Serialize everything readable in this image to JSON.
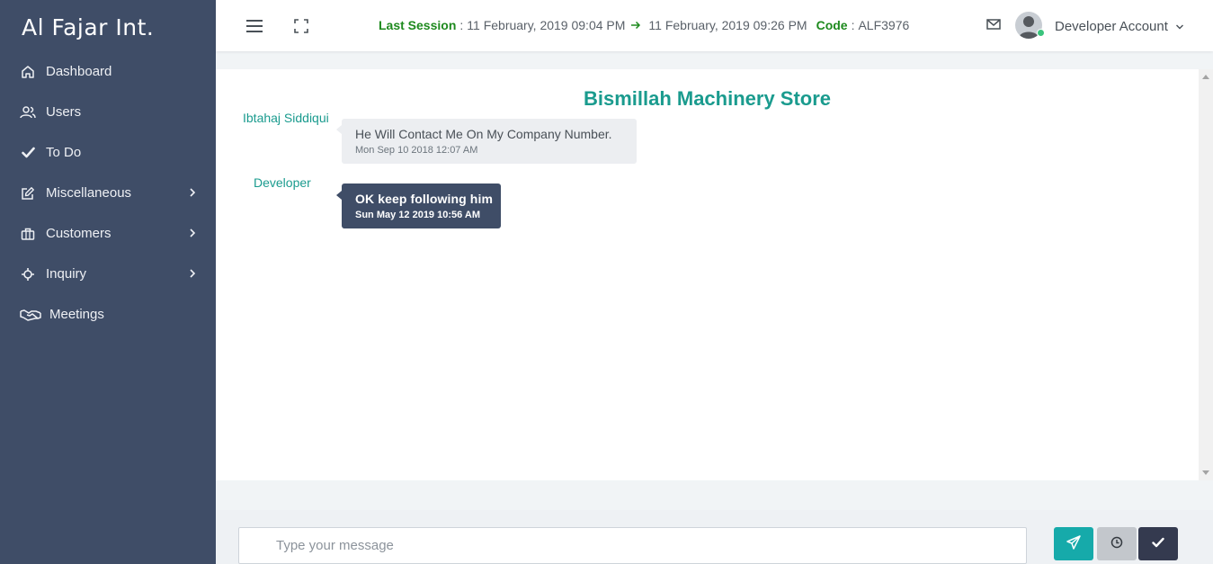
{
  "brand": "Al Fajar Int.",
  "sidebar": {
    "items": [
      {
        "label": "Dashboard",
        "icon": "home-icon",
        "has_children": false
      },
      {
        "label": "Users",
        "icon": "users-icon",
        "has_children": false
      },
      {
        "label": "To Do",
        "icon": "check-icon",
        "has_children": false
      },
      {
        "label": "Miscellaneous",
        "icon": "edit-icon",
        "has_children": true
      },
      {
        "label": "Customers",
        "icon": "briefcase-icon",
        "has_children": true
      },
      {
        "label": "Inquiry",
        "icon": "crosshair-icon",
        "has_children": true
      },
      {
        "label": "Meetings",
        "icon": "handshake-icon",
        "has_children": false
      }
    ]
  },
  "header": {
    "last_session_label": "Last Session",
    "session_start": "11 February, 2019 09:04 PM",
    "session_end": "11 February, 2019 09:26 PM",
    "code_label": "Code",
    "code_value": "ALF3976",
    "account_name": "Developer Account"
  },
  "chat": {
    "title": "Bismillah Machinery Store",
    "messages": [
      {
        "sender": "Ibtahaj Siddiqui",
        "text": "He Will Contact Me On My Company Number.",
        "time": "Mon Sep 10 2018 12:07 AM",
        "direction": "in"
      },
      {
        "sender": "Developer",
        "text": "OK keep following him",
        "time": "Sun May 12 2019 10:56 AM",
        "direction": "out"
      }
    ]
  },
  "composer": {
    "placeholder": "Type your message",
    "value": ""
  },
  "colors": {
    "sidebar_bg": "#3f4d67",
    "accent_teal": "#1a9b8e",
    "session_green": "#1e8a1e",
    "send_button": "#16aaaa",
    "status_online": "#3ac47d"
  }
}
